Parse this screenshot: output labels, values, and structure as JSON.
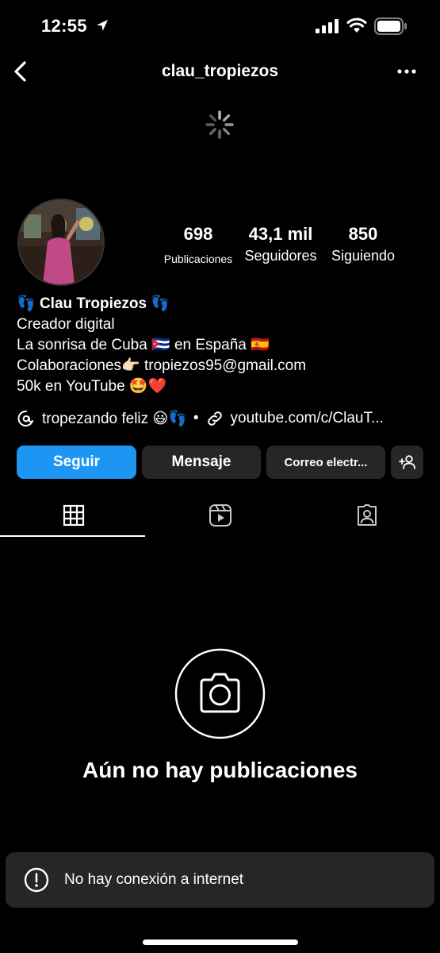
{
  "status_bar": {
    "time": "12:55"
  },
  "nav": {
    "title": "clau_tropiezos"
  },
  "stats": [
    {
      "value": "698",
      "label": "Publicaciones"
    },
    {
      "value": "43,1 mil",
      "label": "Seguidores"
    },
    {
      "value": "850",
      "label": "Siguiendo"
    }
  ],
  "bio": {
    "name_prefix": "👣",
    "name": "Clau Tropiezos",
    "name_suffix": "👣",
    "category": "Creador digital",
    "line1": "La sonrisa de Cuba 🇨🇺  en España 🇪🇸",
    "line2_text": "Colaboraciones👉🏻",
    "line2_email": "tropiezos95@gmail.com",
    "line3": "50k en YouTube 🤩❤️"
  },
  "links": {
    "thread": "tropezando feliz 😃👣",
    "separator": "•",
    "url": "youtube.com/c/ClauT..."
  },
  "buttons": {
    "follow": "Seguir",
    "message": "Mensaje",
    "email": "Correo electr..."
  },
  "tabs": [
    {
      "icon": "grid-icon",
      "active": true
    },
    {
      "icon": "reels-icon",
      "active": false
    },
    {
      "icon": "tagged-icon",
      "active": false
    }
  ],
  "empty_state": {
    "icon": "camera-icon",
    "text": "Aún no hay publicaciones"
  },
  "toast": {
    "icon": "alert-circle-icon",
    "text": "No hay conexión a internet"
  },
  "colors": {
    "accent": "#1c96f2",
    "button_bg": "#262626",
    "background": "#000000",
    "text": "#ffffff"
  }
}
